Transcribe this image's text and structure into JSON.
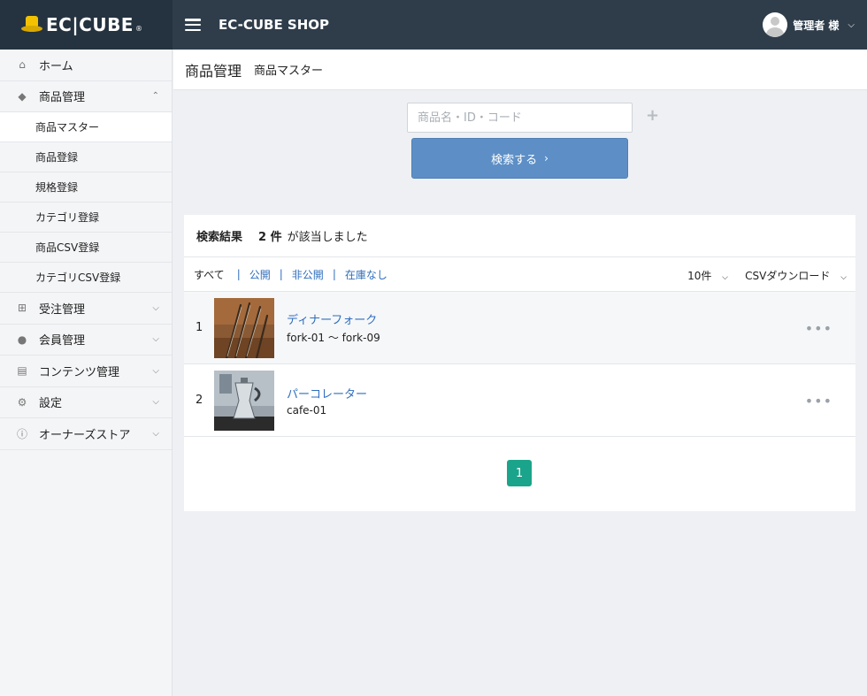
{
  "header": {
    "logo_text": "EC|CUBE",
    "logo_reg": "®",
    "shop_name": "EC-CUBE SHOP",
    "user_name": "管理者 様"
  },
  "sidebar": {
    "items": [
      {
        "label": "ホーム",
        "icon": "home-icon"
      },
      {
        "label": "商品管理",
        "icon": "tag-icon",
        "expanded": true
      },
      {
        "label": "受注管理",
        "icon": "cart-icon"
      },
      {
        "label": "会員管理",
        "icon": "users-icon"
      },
      {
        "label": "コンテンツ管理",
        "icon": "document-icon"
      },
      {
        "label": "設定",
        "icon": "gear-icon"
      },
      {
        "label": "オーナーズストア",
        "icon": "info-icon"
      }
    ],
    "subitems": [
      {
        "label": "商品マスター",
        "active": true
      },
      {
        "label": "商品登録"
      },
      {
        "label": "規格登録"
      },
      {
        "label": "カテゴリ登録"
      },
      {
        "label": "商品CSV登録"
      },
      {
        "label": "カテゴリCSV登録"
      }
    ]
  },
  "page": {
    "title": "商品管理",
    "subtitle": "商品マスター"
  },
  "search": {
    "placeholder": "商品名・ID・コード",
    "button_label": "検索する"
  },
  "results": {
    "label": "検索結果",
    "count": "2 件",
    "suffix": "が該当しました",
    "filters": [
      "すべて",
      "公開",
      "非公開",
      "在庫なし"
    ],
    "per_page": "10件",
    "csv_download": "CSVダウンロード",
    "rows": [
      {
        "num": "1",
        "name": "ディナーフォーク",
        "code": "fork-01 ～ fork-09"
      },
      {
        "num": "2",
        "name": "パーコレーター",
        "code": "cafe-01"
      }
    ],
    "page": "1"
  },
  "colors": {
    "topbar": "#2f3d4b",
    "button": "#5d8fc6",
    "link": "#2f6ebd",
    "pager": "#1aa48b"
  }
}
